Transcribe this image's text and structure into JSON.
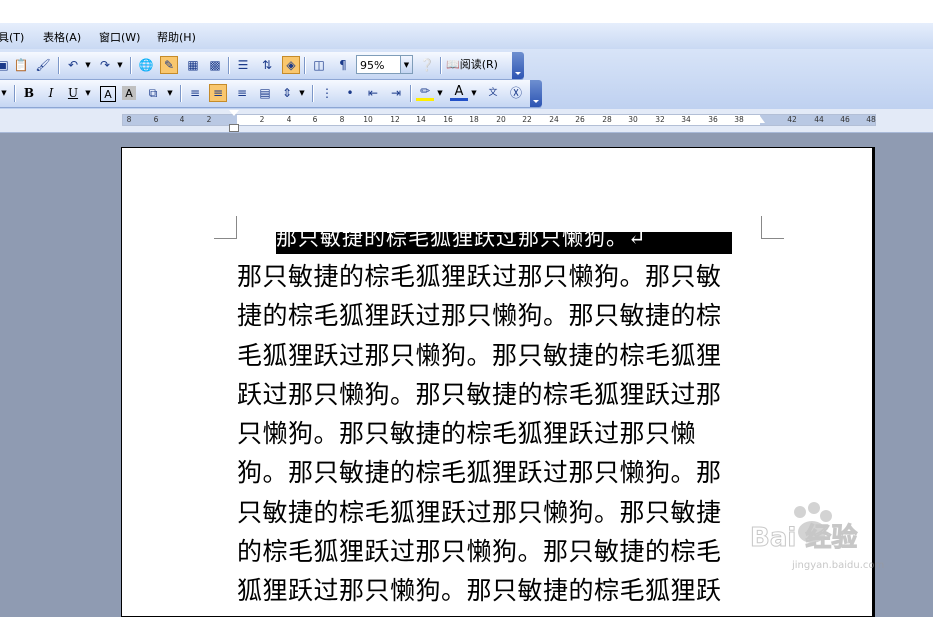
{
  "menu": [
    "具(T)",
    "表格(A)",
    "窗口(W)",
    "帮助(H)"
  ],
  "toolbar1": {
    "zoom_value": "95%",
    "read_label": "阅读(R)"
  },
  "toolbar2": {
    "bold": "B",
    "italic": "I",
    "underline": "U",
    "char_border": "A",
    "char_shading": "A",
    "font_color": "A"
  },
  "ruler": {
    "ticks": [
      "8",
      "6",
      "4",
      "2",
      "2",
      "4",
      "6",
      "8",
      "10",
      "12",
      "14",
      "16",
      "18",
      "20",
      "22",
      "24",
      "26",
      "28",
      "30",
      "32",
      "34",
      "36",
      "38",
      "42",
      "44",
      "46",
      "48"
    ]
  },
  "document": {
    "heading": "那只敏捷的棕毛狐狸跃过那只懒狗。↵",
    "lines": [
      "那只敏捷的棕毛狐狸跃过那只懒狗。那只敏",
      "捷的棕毛狐狸跃过那只懒狗。那只敏捷的棕",
      "毛狐狸跃过那只懒狗。那只敏捷的棕毛狐狸",
      "跃过那只懒狗。那只敏捷的棕毛狐狸跃过那",
      "只懒狗。那只敏捷的棕毛狐狸跃过那只懒",
      "狗。那只敏捷的棕毛狐狸跃过那只懒狗。那",
      "只敏捷的棕毛狐狸跃过那只懒狗。那只敏捷",
      "的棕毛狐狸跃过那只懒狗。那只敏捷的棕毛",
      "狐狸跃过那只懒狗。那只敏捷的棕毛狐狸跃"
    ]
  },
  "watermark": {
    "text": "Bai 经验",
    "url": "jingyan.baidu.com"
  }
}
